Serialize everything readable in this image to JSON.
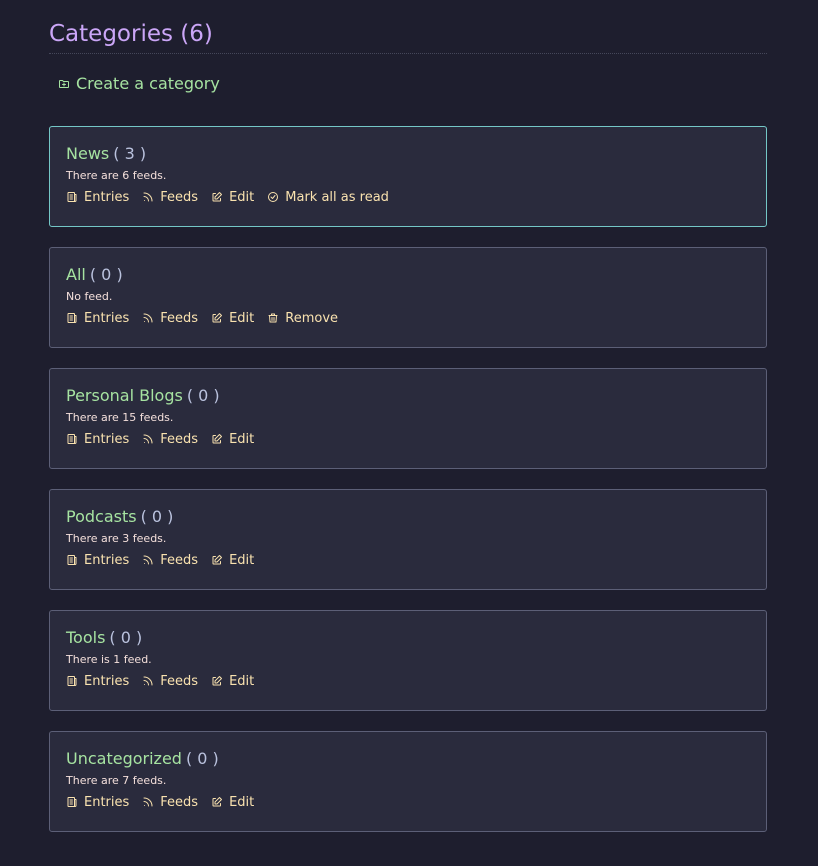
{
  "page": {
    "title": "Categories (6)"
  },
  "create": {
    "label": "Create a category",
    "icon": "folder-plus-icon"
  },
  "colors": {
    "title": "#cba6f7",
    "link": "#a6e3a1",
    "action": "#f9e2af",
    "card_bg": "#2a2b3d",
    "current_border": "#74c7c7"
  },
  "categories": [
    {
      "name": "News",
      "count": "( 3 )",
      "info": "There are 6 feeds.",
      "actions": {
        "entries": "Entries",
        "feeds": "Feeds",
        "edit": "Edit",
        "extra": "Mark all as read"
      }
    },
    {
      "name": "All",
      "count": "( 0 )",
      "info": "No feed.",
      "actions": {
        "entries": "Entries",
        "feeds": "Feeds",
        "edit": "Edit",
        "extra": "Remove"
      }
    },
    {
      "name": "Personal Blogs",
      "count": "( 0 )",
      "info": "There are 15 feeds.",
      "actions": {
        "entries": "Entries",
        "feeds": "Feeds",
        "edit": "Edit"
      }
    },
    {
      "name": "Podcasts",
      "count": "( 0 )",
      "info": "There are 3 feeds.",
      "actions": {
        "entries": "Entries",
        "feeds": "Feeds",
        "edit": "Edit"
      }
    },
    {
      "name": "Tools",
      "count": "( 0 )",
      "info": "There is 1 feed.",
      "actions": {
        "entries": "Entries",
        "feeds": "Feeds",
        "edit": "Edit"
      }
    },
    {
      "name": "Uncategorized",
      "count": "( 0 )",
      "info": "There are 7 feeds.",
      "actions": {
        "entries": "Entries",
        "feeds": "Feeds",
        "edit": "Edit"
      }
    }
  ]
}
